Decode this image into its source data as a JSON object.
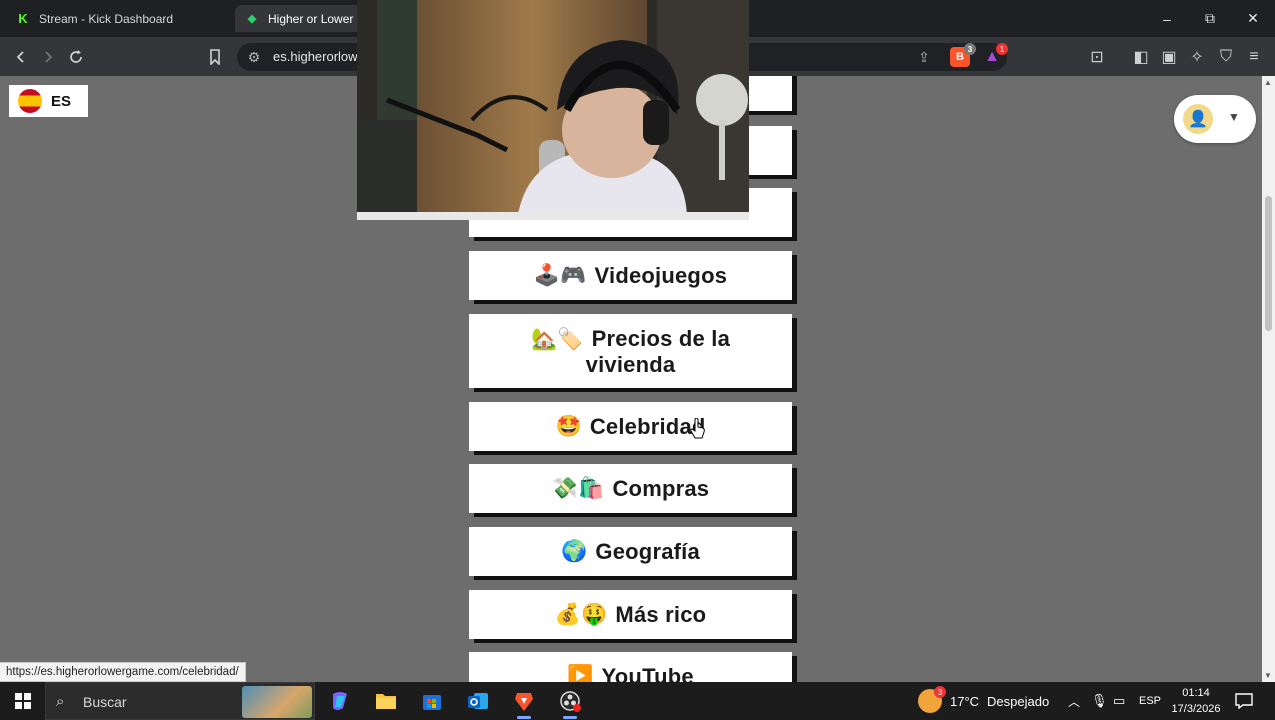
{
  "browser": {
    "tabs": [
      {
        "label": "Stream - Kick Dashboard",
        "icon": "kick-logo-icon"
      },
      {
        "label": "Higher or Lower E",
        "icon": "higher-lower-logo-icon",
        "active": true
      }
    ],
    "url": "es.higherorlow",
    "window_controls": {
      "minimize": "–",
      "maximize": "⧉",
      "close": "✕"
    },
    "brave_badge": "3",
    "rewards_badge": "1"
  },
  "page": {
    "language_button": {
      "label": "ES",
      "flag": "spain-flag-icon"
    },
    "categories": [
      {
        "emoji": "",
        "label": ""
      },
      {
        "emoji": "",
        "label": ""
      },
      {
        "emoji": "",
        "label": ""
      },
      {
        "emoji": "🕹️🎮",
        "label": "Videojuegos"
      },
      {
        "emoji": "🏡🏷️",
        "label": "Precios de la vivienda"
      },
      {
        "emoji": "🤩",
        "label": "Celebridad"
      },
      {
        "emoji": "💸🛍️",
        "label": "Compras"
      },
      {
        "emoji": "🌍",
        "label": "Geografía"
      },
      {
        "emoji": "💰🤑",
        "label": "Más rico"
      },
      {
        "emoji": "▶️",
        "label": "YouTube"
      }
    ],
    "status_url": "https://es.higherorlowergame.com/celebridad/"
  },
  "taskbar": {
    "search_placeholder": "Buscar",
    "weather": {
      "temp": "17°C",
      "condition": "Despejado",
      "badge": "3"
    },
    "language": "ESP",
    "time": "01:14",
    "date": "17/3/2026"
  },
  "colors": {
    "page_bg": "#6d6d6d",
    "card_bg": "#ffffff",
    "card_shadow": "#111111",
    "tab_bar": "#1f2024",
    "toolbar": "#35363a"
  }
}
